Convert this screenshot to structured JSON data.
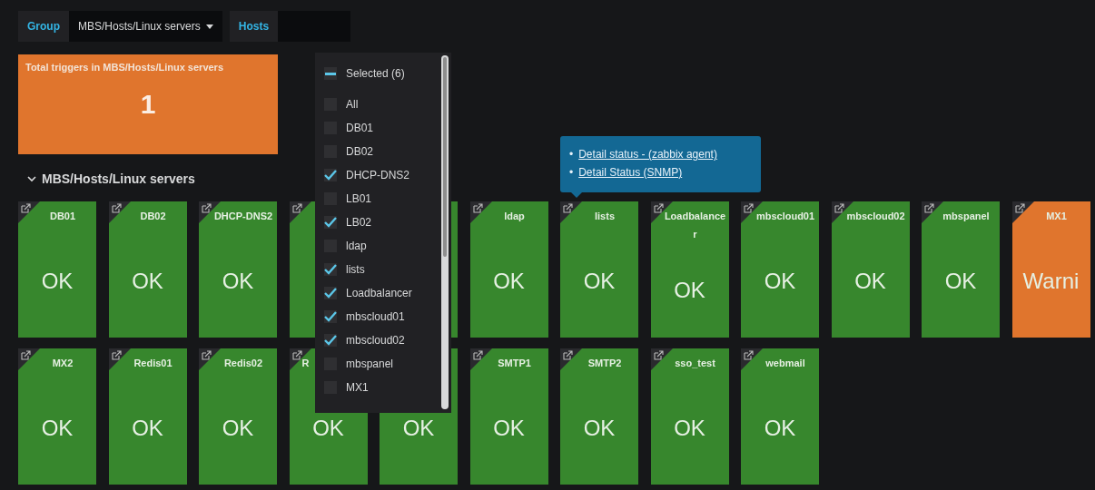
{
  "filters": [
    {
      "label": "Group",
      "value": "MBS/Hosts/Linux servers",
      "kind": "dropdown"
    },
    {
      "label": "Hosts",
      "kind": "input"
    }
  ],
  "stat_panel": {
    "title": "Total triggers in MBS/Hosts/Linux servers",
    "value": "1",
    "color": "#e0752d"
  },
  "section": {
    "title": "MBS/Hosts/Linux servers",
    "expanded": true
  },
  "tiles": [
    {
      "name": "DB01",
      "status": "OK",
      "color": "#37872d"
    },
    {
      "name": "DB02",
      "status": "OK",
      "color": "#37872d"
    },
    {
      "name": "DHCP-DNS2",
      "status": "OK",
      "color": "#37872d"
    },
    {
      "color": "#37872d"
    },
    {
      "color": "#37872d",
      "kind": "under-menu"
    },
    {
      "name": "ldap",
      "status": "OK",
      "color": "#37872d"
    },
    {
      "name": "lists",
      "status": "OK",
      "color": "#37872d"
    },
    {
      "name": "Loadbalancer",
      "status": "OK",
      "color": "#37872d"
    },
    {
      "name": "mbscloud01",
      "status": "OK",
      "color": "#37872d"
    },
    {
      "name": "mbscloud02",
      "status": "OK",
      "color": "#37872d"
    },
    {
      "name": "mbspanel",
      "status": "OK",
      "color": "#37872d"
    },
    {
      "name": "MX1",
      "status": "Warni",
      "color": "#e0752d"
    },
    {
      "name": "MX2",
      "status": "OK",
      "color": "#37872d"
    },
    {
      "name": "Redis01",
      "status": "OK",
      "color": "#37872d"
    },
    {
      "name": "Redis02",
      "status": "OK",
      "color": "#37872d"
    },
    {
      "name": "R",
      "status": "OK",
      "color": "#37872d",
      "kind": "covered"
    },
    {
      "status": "OK",
      "color": "#37872d",
      "kind": "under-menu"
    },
    {
      "name": "SMTP1",
      "status": "OK",
      "color": "#37872d"
    },
    {
      "name": "SMTP2",
      "status": "OK",
      "color": "#37872d"
    },
    {
      "name": "sso_test",
      "status": "OK",
      "color": "#37872d"
    },
    {
      "name": "webmail",
      "status": "OK",
      "color": "#37872d"
    }
  ],
  "host_menu": {
    "header": {
      "label": "Selected (6)",
      "indeterminate": true
    },
    "items": [
      {
        "label": "All",
        "checked": false
      },
      {
        "label": "DB01",
        "checked": false
      },
      {
        "label": "DB02",
        "checked": false
      },
      {
        "label": "DHCP-DNS2",
        "checked": true
      },
      {
        "label": "LB01",
        "checked": false
      },
      {
        "label": "LB02",
        "checked": true
      },
      {
        "label": "ldap",
        "checked": false
      },
      {
        "label": "lists",
        "checked": true
      },
      {
        "label": "Loadbalancer",
        "checked": true
      },
      {
        "label": "mbscloud01",
        "checked": true
      },
      {
        "label": "mbscloud02",
        "checked": true
      },
      {
        "label": "mbspanel",
        "checked": false
      },
      {
        "label": "MX1",
        "checked": false
      }
    ]
  },
  "tooltip": {
    "links": [
      {
        "bullet": "•",
        "text": "Detail status - (zabbix agent)"
      },
      {
        "bullet": "•",
        "text": "Detail Status (SNMP)"
      }
    ]
  }
}
